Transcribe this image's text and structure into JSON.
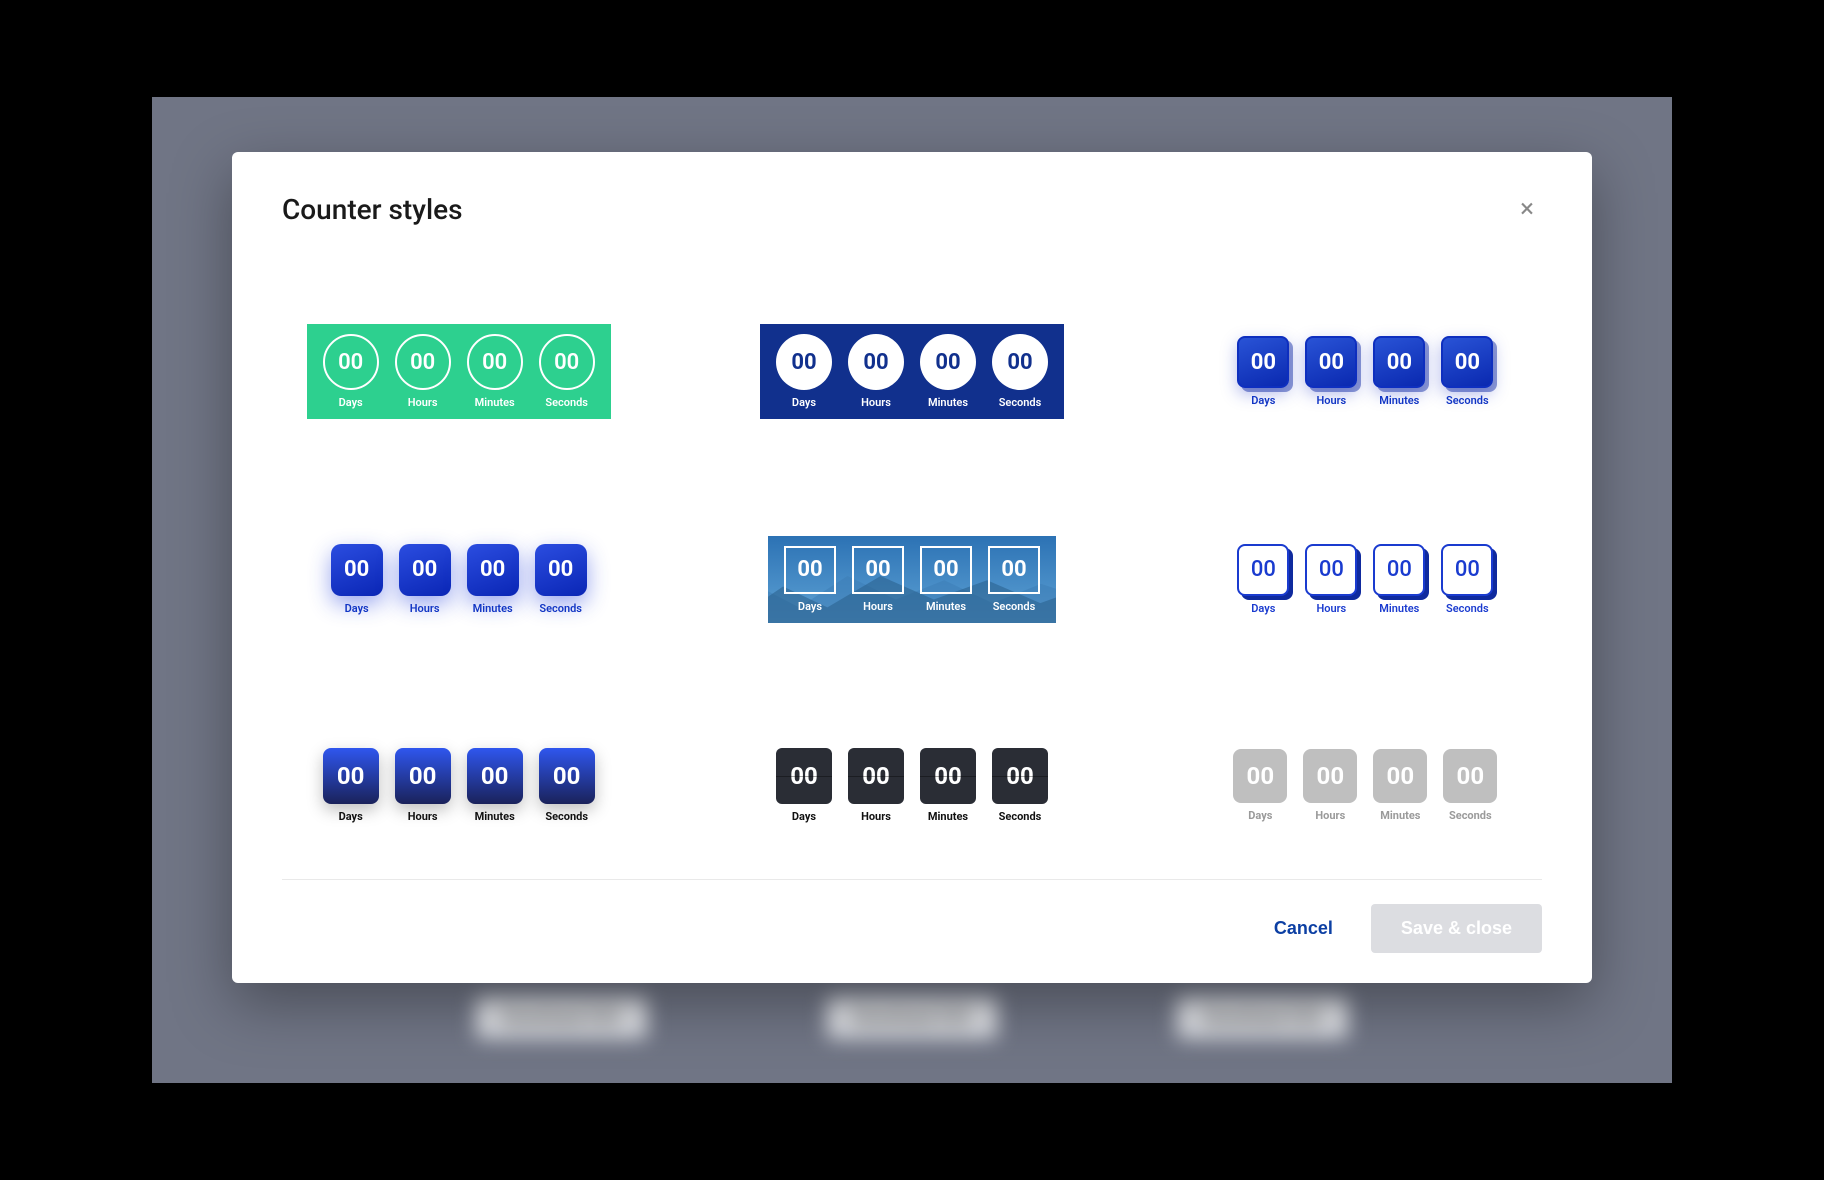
{
  "modal": {
    "title": "Counter styles",
    "close_glyph": "×"
  },
  "units": {
    "value": "00",
    "labels": [
      "Days",
      "Hours",
      "Minutes",
      "Seconds"
    ]
  },
  "footer": {
    "cancel": "Cancel",
    "save": "Save & close"
  },
  "background_buttons": [
    "Download CSV",
    "Download CSV",
    "Download CSV"
  ],
  "colors": {
    "green": "#2dd08f",
    "navy": "#11308d",
    "blue": "#1a3bcf",
    "dark": "#2a2d35",
    "gray": "#bfbfbf"
  }
}
